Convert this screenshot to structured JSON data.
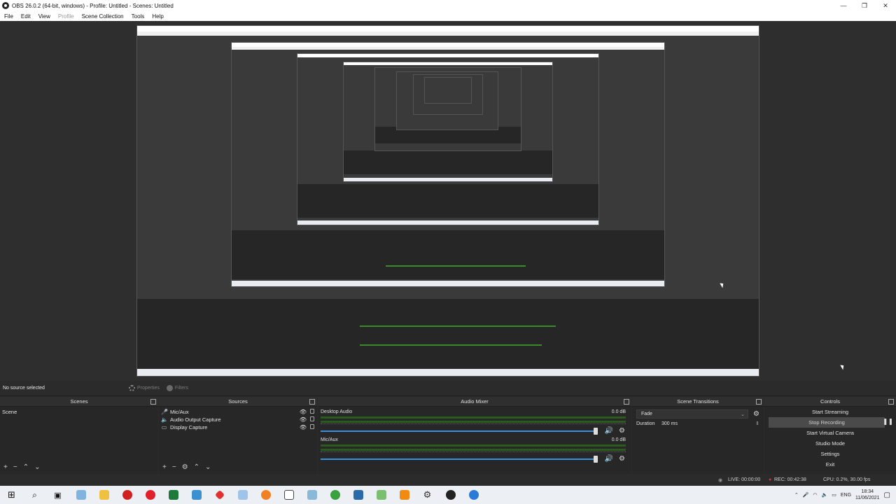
{
  "window": {
    "title": "OBS 26.0.2 (64-bit, windows) - Profile: Untitled - Scenes: Untitled",
    "controls": [
      "—",
      "❐",
      "✕"
    ]
  },
  "menu": {
    "items": [
      "File",
      "Edit",
      "View",
      "Profile",
      "Scene Collection",
      "Tools",
      "Help"
    ]
  },
  "source_bar": {
    "no_source": "No source selected",
    "properties": "Properties",
    "filters": "Filters"
  },
  "scenes": {
    "title": "Scenes",
    "items": [
      "Scene"
    ]
  },
  "sources": {
    "title": "Sources",
    "items": [
      {
        "name": "Mic/Aux",
        "icon": "mic-icon"
      },
      {
        "name": "Audio Output Capture",
        "icon": "speaker-icon"
      },
      {
        "name": "Display Capture",
        "icon": "monitor-icon"
      }
    ]
  },
  "audio_mixer": {
    "title": "Audio Mixer",
    "channels": [
      {
        "name": "Desktop Audio",
        "db": "0.0 dB"
      },
      {
        "name": "Mic/Aux",
        "db": "0.0 dB"
      }
    ]
  },
  "scene_transitions": {
    "title": "Scene Transitions",
    "transition": "Fade",
    "duration_label": "Duration",
    "duration_value": "300 ms"
  },
  "controls": {
    "title": "Controls",
    "buttons": [
      "Start Streaming",
      "Stop Recording",
      "Start Virtual Camera",
      "Studio Mode",
      "Settings",
      "Exit"
    ]
  },
  "status": {
    "live": "LIVE: 00:00:00",
    "rec": "REC: 00:42:38",
    "cpu": "CPU: 0.2%, 30.00 fps"
  },
  "taskbar": {
    "icons": [
      "windows-start-icon",
      "search-icon",
      "task-view-icon",
      "files-icon",
      "folder-icon",
      "app-t-icon",
      "opera-icon",
      "green-app-icon",
      "blue-app-icon",
      "red-app-icon",
      "window-app-icon",
      "search-app-icon",
      "notes-app-icon",
      "feather-app-icon",
      "chrome-icon",
      "share-app-icon",
      "pen-app-icon",
      "vlc-icon",
      "gear-app-icon",
      "obs-icon",
      "browser-icon"
    ],
    "lang": "ENG",
    "time": "18:34",
    "date": "11/06/2021"
  },
  "colors": {
    "dock_bg": "#272727",
    "slider_blue": "#3b8fd9",
    "meter_green": "#3a8a2a",
    "rec_red": "#e03030"
  }
}
